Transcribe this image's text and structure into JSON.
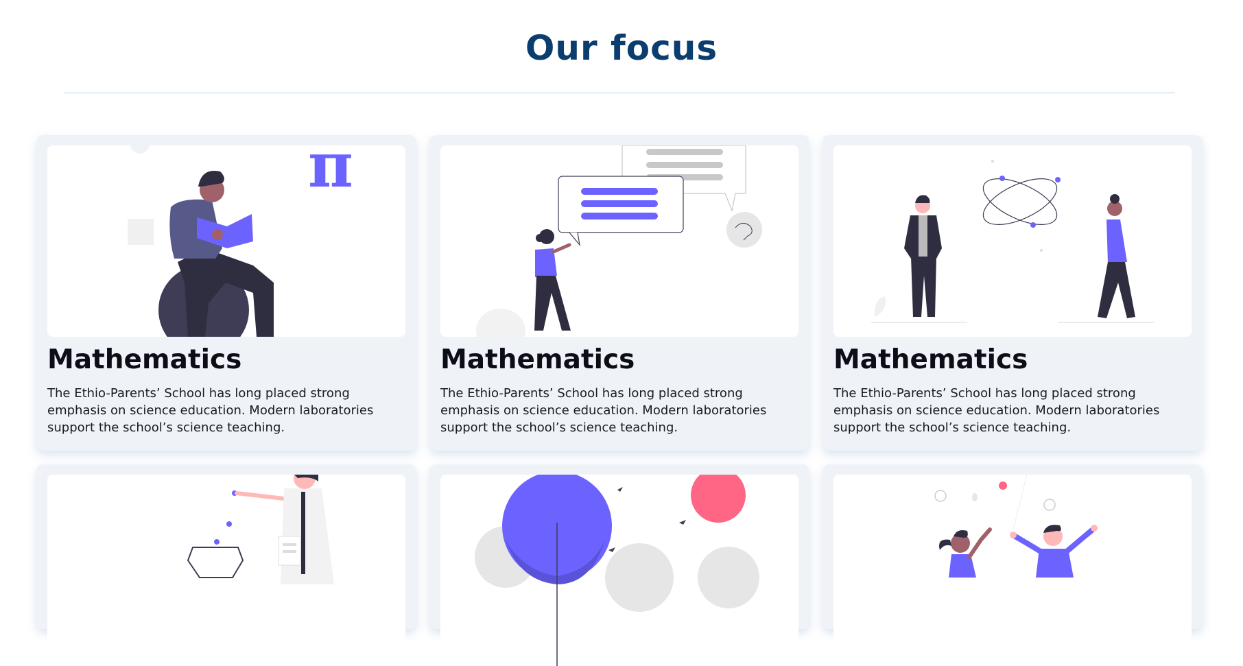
{
  "section": {
    "title": "Our focus"
  },
  "cards": [
    {
      "title": "Mathematics",
      "text": "The Ethio-Parents’ School has long placed strong emphasis on science education. Modern laboratories support the school’s science teaching.",
      "illustration": "reading-person-pi-illustration"
    },
    {
      "title": "Mathematics",
      "text": "The Ethio-Parents’ School has long placed strong emphasis on science education. Modern laboratories support the school’s science teaching.",
      "illustration": "speech-bubbles-illustration"
    },
    {
      "title": "Mathematics",
      "text": "The Ethio-Parents’ School has long placed strong emphasis on science education. Modern laboratories support the school’s science teaching.",
      "illustration": "atom-people-illustration"
    },
    {
      "illustration": "lab-scientist-illustration"
    },
    {
      "illustration": "nature-circles-illustration"
    },
    {
      "illustration": "celebrating-people-illustration"
    }
  ],
  "colors": {
    "title": "#0b3d6e",
    "accent": "#6c63ff",
    "card_bg": "#eff3f8",
    "pink": "#ff6584"
  }
}
